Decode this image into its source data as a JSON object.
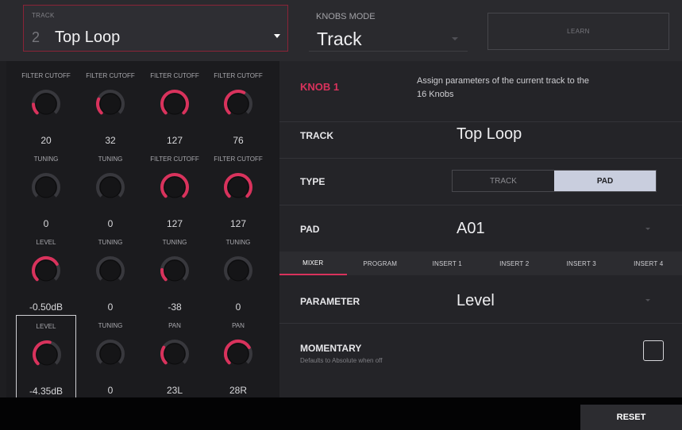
{
  "header": {
    "track_label": "TRACK",
    "track_number": "2",
    "track_name": "Top Loop",
    "knobs_mode_label": "KNOBS MODE",
    "knobs_mode_value": "Track",
    "learn_label": "LEARN"
  },
  "knobs": [
    {
      "label": "FILTER CUTOFF",
      "value": "20",
      "level": 0.16
    },
    {
      "label": "FILTER CUTOFF",
      "value": "32",
      "level": 0.25
    },
    {
      "label": "FILTER CUTOFF",
      "value": "127",
      "level": 1.0
    },
    {
      "label": "FILTER CUTOFF",
      "value": "76",
      "level": 0.6
    },
    {
      "label": "TUNING",
      "value": "0",
      "level": 0.0
    },
    {
      "label": "TUNING",
      "value": "0",
      "level": 0.0
    },
    {
      "label": "FILTER CUTOFF",
      "value": "127",
      "level": 1.0
    },
    {
      "label": "FILTER CUTOFF",
      "value": "127",
      "level": 1.0
    },
    {
      "label": "LEVEL",
      "value": "-0.50dB",
      "level": 0.72
    },
    {
      "label": "TUNING",
      "value": "0",
      "level": 0.0
    },
    {
      "label": "TUNING",
      "value": "-38",
      "level": 0.18
    },
    {
      "label": "TUNING",
      "value": "0",
      "level": 0.0
    },
    {
      "label": "LEVEL",
      "value": "-4.35dB",
      "level": 0.55
    },
    {
      "label": "TUNING",
      "value": "0",
      "level": 0.0
    },
    {
      "label": "PAN",
      "value": "23L",
      "level": 0.28
    },
    {
      "label": "PAN",
      "value": "28R",
      "level": 0.72
    }
  ],
  "detail": {
    "knob_title": "KNOB 1",
    "description": "Assign parameters of the current track to the 16 Knobs",
    "track_label": "TRACK",
    "track_value": "Top Loop",
    "type_label": "TYPE",
    "type_options": [
      "TRACK",
      "PAD"
    ],
    "type_selected": "PAD",
    "pad_label": "PAD",
    "pad_value": "A01",
    "tabs": [
      "MIXER",
      "PROGRAM",
      "INSERT 1",
      "INSERT 2",
      "INSERT 3",
      "INSERT 4"
    ],
    "active_tab": "MIXER",
    "parameter_label": "PARAMETER",
    "parameter_value": "Level",
    "momentary_label": "MOMENTARY",
    "momentary_sub": "Defaults to Absolute when off"
  },
  "footer": {
    "reset_label": "RESET"
  },
  "colors": {
    "accent": "#d9325c",
    "panel": "#242428",
    "knob_fill": "#151517"
  }
}
